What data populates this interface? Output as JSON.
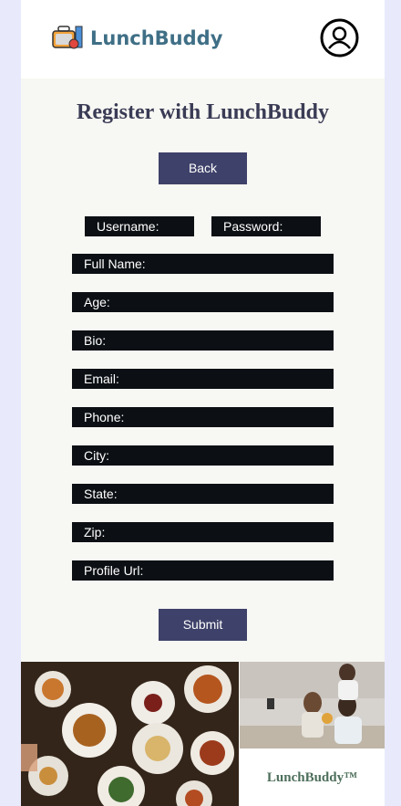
{
  "header": {
    "brand": "LunchBuddy",
    "logo_icon": "lunchbox-logo-icon",
    "profile_icon": "user-profile-icon"
  },
  "title": "Register with LunchBuddy",
  "buttons": {
    "back": "Back",
    "submit": "Submit"
  },
  "fields": {
    "username": "Username:",
    "password": "Password:",
    "full_name": "Full Name:",
    "age": "Age:",
    "bio": "Bio:",
    "email": "Email:",
    "phone": "Phone:",
    "city": "City:",
    "state": "State:",
    "zip": "Zip:",
    "profile_url": "Profile Url:"
  },
  "footer": {
    "brand": "LunchBuddy™"
  },
  "colors": {
    "header_bg": "#ffffff",
    "page_bg": "#f7f7f3",
    "outer_bg": "#e8e9fb",
    "button_bg": "#3e4169",
    "field_bg": "#0c1014",
    "brand_text": "#3f6f86",
    "footer_brand": "#4d6f5b"
  }
}
